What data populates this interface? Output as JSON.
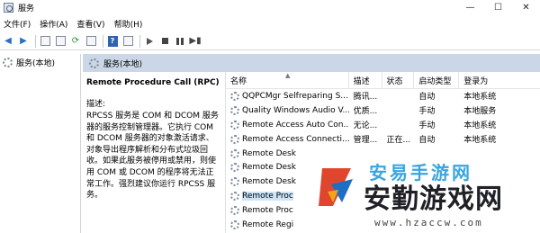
{
  "window": {
    "title": "服务",
    "minimize": "—",
    "maximize": "☐",
    "close": "✕"
  },
  "menu": [
    "文件(F)",
    "操作(A)",
    "查看(V)",
    "帮助(H)"
  ],
  "tree": {
    "item": "服务(本地)"
  },
  "main": {
    "header": "服务(本地)"
  },
  "detail": {
    "service_name": "Remote Procedure Call (RPC)",
    "description_label": "描述:",
    "description": "RPCSS 服务是 COM 和 DCOM 服务器的服务控制管理器。它执行 COM 和 DCOM 服务器的对象激活请求、对象导出程序解析和分布式垃圾回收。如果此服务被停用或禁用，则使用 COM 或 DCOM 的程序将无法正常工作。强烈建议你运行 RPCSS 服务。"
  },
  "table": {
    "columns": [
      "名称",
      "描述",
      "状态",
      "启动类型",
      "登录为"
    ],
    "rows": [
      [
        "QQPCMgr Selfreparing S...",
        "腾讯...",
        "",
        "自动",
        "本地系统"
      ],
      [
        "Quality Windows Audio V...",
        "优质...",
        "",
        "手动",
        "本地服务"
      ],
      [
        "Remote Access Auto Con...",
        "无论...",
        "",
        "手动",
        "本地系统"
      ],
      [
        "Remote Access Connecti...",
        "管理...",
        "正在...",
        "自动",
        "本地系统"
      ],
      [
        "Remote Desk",
        "",
        "",
        "",
        ""
      ],
      [
        "Remote Desk",
        "",
        "",
        "",
        ""
      ],
      [
        "Remote Desk",
        "",
        "",
        "",
        ""
      ],
      [
        "Remote Proc",
        "",
        "",
        "",
        ""
      ],
      [
        "Remote Proc",
        "",
        "",
        "",
        ""
      ],
      [
        "Remote Regi",
        "",
        "",
        "",
        ""
      ]
    ],
    "selected_row": 7
  },
  "watermark": {
    "top": "安易手游网",
    "main": "安勤游戏网",
    "url": "www.hzaccw.com"
  },
  "colors": {
    "header_bg": "#cbd7e6",
    "accent_blue": "#2d62b5",
    "selected": "#cce4f7"
  }
}
